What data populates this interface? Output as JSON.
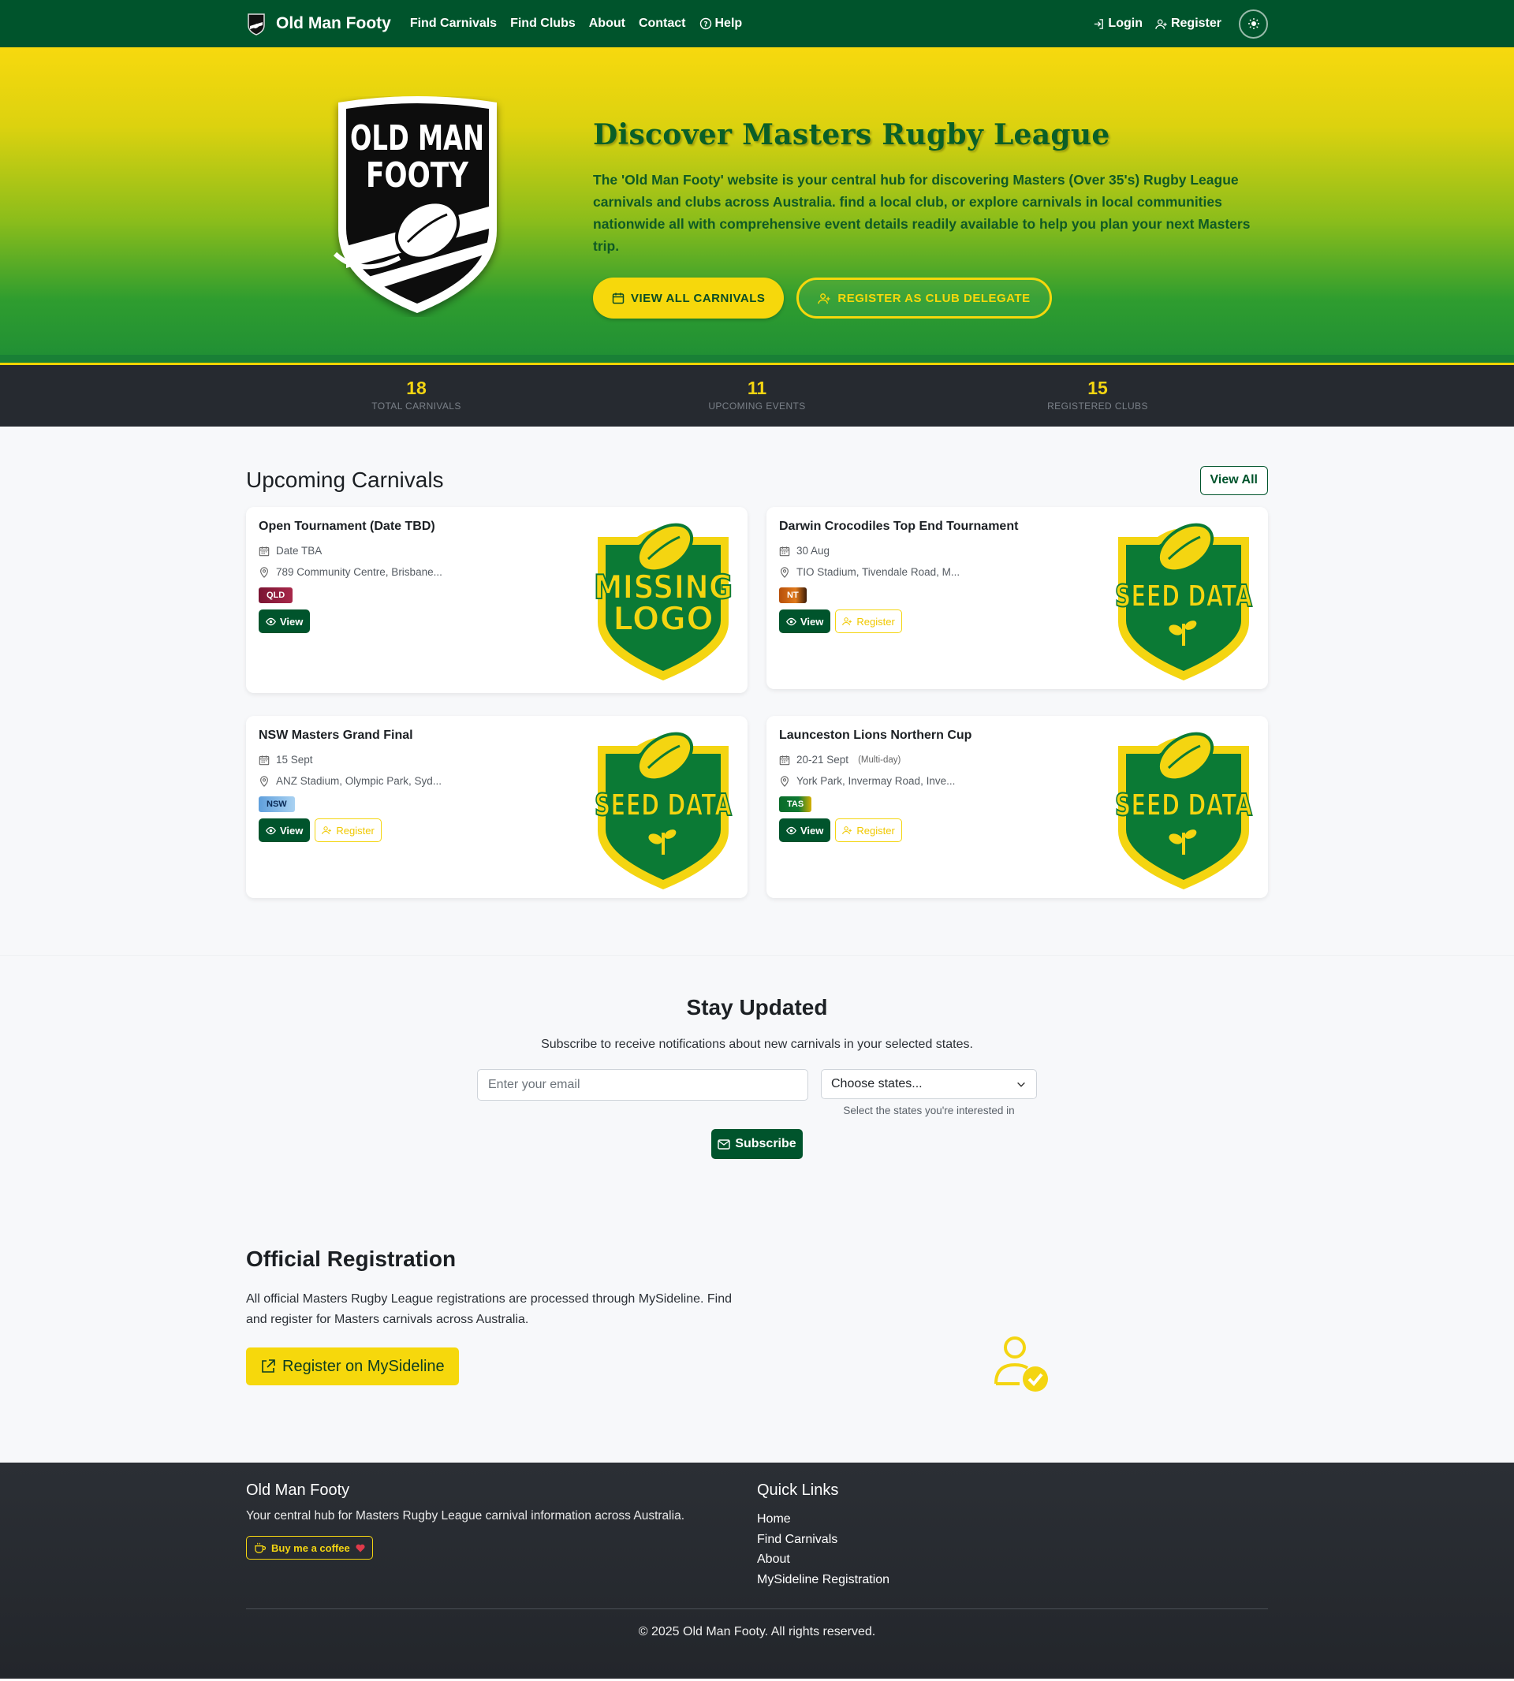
{
  "nav": {
    "brand": "Old Man Footy",
    "links": [
      "Find Carnivals",
      "Find Clubs",
      "About",
      "Contact",
      "Help"
    ],
    "login": "Login",
    "register": "Register"
  },
  "hero": {
    "logo_text_line1": "OLD MAN",
    "logo_text_line2": "FOOTY",
    "title": "Discover Masters Rugby League",
    "description": "The 'Old Man Footy' website is your central hub for discovering Masters (Over 35's) Rugby League carnivals and clubs across Australia. find a local club, or explore carnivals in local communities nationwide all with comprehensive event details readily available to help you plan your next Masters trip.",
    "btn_primary": "VIEW ALL CARNIVALS",
    "btn_secondary": "REGISTER AS CLUB DELEGATE"
  },
  "stats": [
    {
      "value": "18",
      "label": "TOTAL CARNIVALS"
    },
    {
      "value": "11",
      "label": "UPCOMING EVENTS"
    },
    {
      "value": "15",
      "label": "REGISTERED CLUBS"
    }
  ],
  "upcoming": {
    "title": "Upcoming Carnivals",
    "view_all": "View All",
    "view_label": "View",
    "register_label": "Register",
    "cards": [
      {
        "title": "Open Tournament (Date TBD)",
        "date": "Date TBA",
        "date_sub": "",
        "location": "789 Community Centre, Brisbane...",
        "state": "QLD",
        "logo_line1": "MISSING",
        "logo_line2": "LOGO"
      },
      {
        "title": "Darwin Crocodiles Top End Tournament",
        "date": "30 Aug",
        "date_sub": "",
        "location": "TIO Stadium, Tivendale Road, M...",
        "state": "NT",
        "logo_line1": "SEED DATA",
        "logo_line2": ""
      },
      {
        "title": "NSW Masters Grand Final",
        "date": "15 Sept",
        "date_sub": "",
        "location": "ANZ Stadium, Olympic Park, Syd...",
        "state": "NSW",
        "logo_line1": "SEED DATA",
        "logo_line2": ""
      },
      {
        "title": "Launceston Lions Northern Cup",
        "date": "20-21 Sept",
        "date_sub": "(Multi-day)",
        "location": "York Park, Invermay Road, Inve...",
        "state": "TAS",
        "logo_line1": "SEED DATA",
        "logo_line2": ""
      }
    ]
  },
  "subscribe": {
    "title": "Stay Updated",
    "description": "Subscribe to receive notifications about new carnivals in your selected states.",
    "email_placeholder": "Enter your email",
    "select_value": "Choose states...",
    "select_help": "Select the states you're interested in",
    "button": "Subscribe"
  },
  "official": {
    "title": "Official Registration",
    "text": "All official Masters Rugby League registrations are processed through MySideline. Find and register for Masters carnivals across Australia.",
    "button": "Register on MySideline"
  },
  "footer": {
    "title": "Old Man Footy",
    "description": "Your central hub for Masters Rugby League carnival information across Australia.",
    "coffee": "Buy me a coffee",
    "quick_links_title": "Quick Links",
    "quick_links": [
      "Home",
      "Find Carnivals",
      "About",
      "MySideline Registration"
    ],
    "copyright": "© 2025 Old Man Footy. All rights reserved."
  },
  "colors": {
    "primary_green": "#00542c",
    "gold": "#f6d80c",
    "dark": "#262a30",
    "qld": "#8b1d3a",
    "nt": "#c05a10",
    "nsw": "#7fb6e6",
    "tas": "#0a6b2a"
  }
}
